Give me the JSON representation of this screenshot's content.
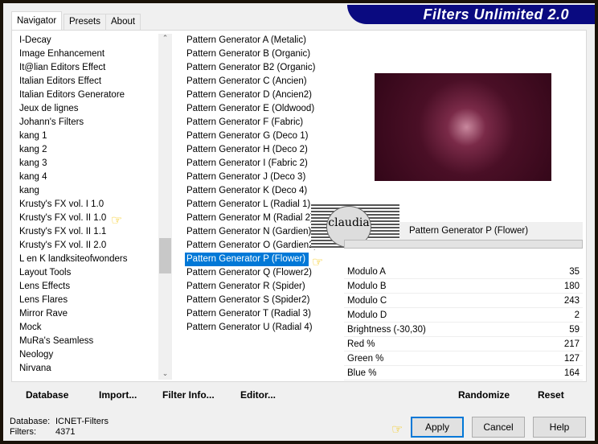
{
  "brand": "Filters Unlimited 2.0",
  "tabs": [
    "Navigator",
    "Presets",
    "About"
  ],
  "categories": [
    "I-Decay",
    "Image Enhancement",
    "It@lian Editors Effect",
    "Italian Editors Effect",
    "Italian Editors Generatore",
    "Jeux de lignes",
    "Johann's Filters",
    "kang 1",
    "kang 2",
    "kang 3",
    "kang 4",
    "kang",
    "Krusty's FX vol. I 1.0",
    "Krusty's FX vol. II 1.0",
    "Krusty's FX vol. II 1.1",
    "Krusty's FX vol. II 2.0",
    "L en K landksiteofwonders",
    "Layout Tools",
    "Lens Effects",
    "Lens Flares",
    "Mirror Rave",
    "Mock",
    "MuRa's Seamless",
    "Neology",
    "Nirvana"
  ],
  "filters": [
    "Pattern Generator A (Metalic)",
    "Pattern Generator B (Organic)",
    "Pattern Generator B2 (Organic)",
    "Pattern Generator C (Ancien)",
    "Pattern Generator D (Ancien2)",
    "Pattern Generator E (Oldwood)",
    "Pattern Generator F (Fabric)",
    "Pattern Generator G (Deco 1)",
    "Pattern Generator H (Deco 2)",
    "Pattern Generator I (Fabric 2)",
    "Pattern Generator J (Deco 3)",
    "Pattern Generator K (Deco 4)",
    "Pattern Generator L (Radial 1)",
    "Pattern Generator M (Radial 2)",
    "Pattern Generator N (Gardien)",
    "Pattern Generator O (Gardien2)",
    "Pattern Generator P (Flower)",
    "Pattern Generator Q (Flower2)",
    "Pattern Generator R (Spider)",
    "Pattern Generator S (Spider2)",
    "Pattern Generator T (Radial 3)",
    "Pattern Generator U (Radial 4)"
  ],
  "selected_filter": "Pattern Generator P (Flower)",
  "watermark": "claudia",
  "params": [
    {
      "label": "Modulo A",
      "value": "35"
    },
    {
      "label": "Modulo B",
      "value": "180"
    },
    {
      "label": "Modulo C",
      "value": "243"
    },
    {
      "label": "Modulo D",
      "value": "2"
    },
    {
      "label": "Brightness (-30,30)",
      "value": "59"
    },
    {
      "label": "Red %",
      "value": "217"
    },
    {
      "label": "Green %",
      "value": "127"
    },
    {
      "label": "Blue %",
      "value": "164"
    }
  ],
  "toolbar": {
    "database": "Database",
    "import": "Import...",
    "filter_info": "Filter Info...",
    "editor": "Editor...",
    "randomize": "Randomize",
    "reset": "Reset"
  },
  "status": {
    "db_label": "Database:",
    "db_value": "ICNET-Filters",
    "filters_label": "Filters:",
    "filters_value": "4371"
  },
  "buttons": {
    "apply": "Apply",
    "cancel": "Cancel",
    "help": "Help"
  },
  "colors": {
    "selection": "#0078d7",
    "brand_bg": "#0a0a80"
  }
}
